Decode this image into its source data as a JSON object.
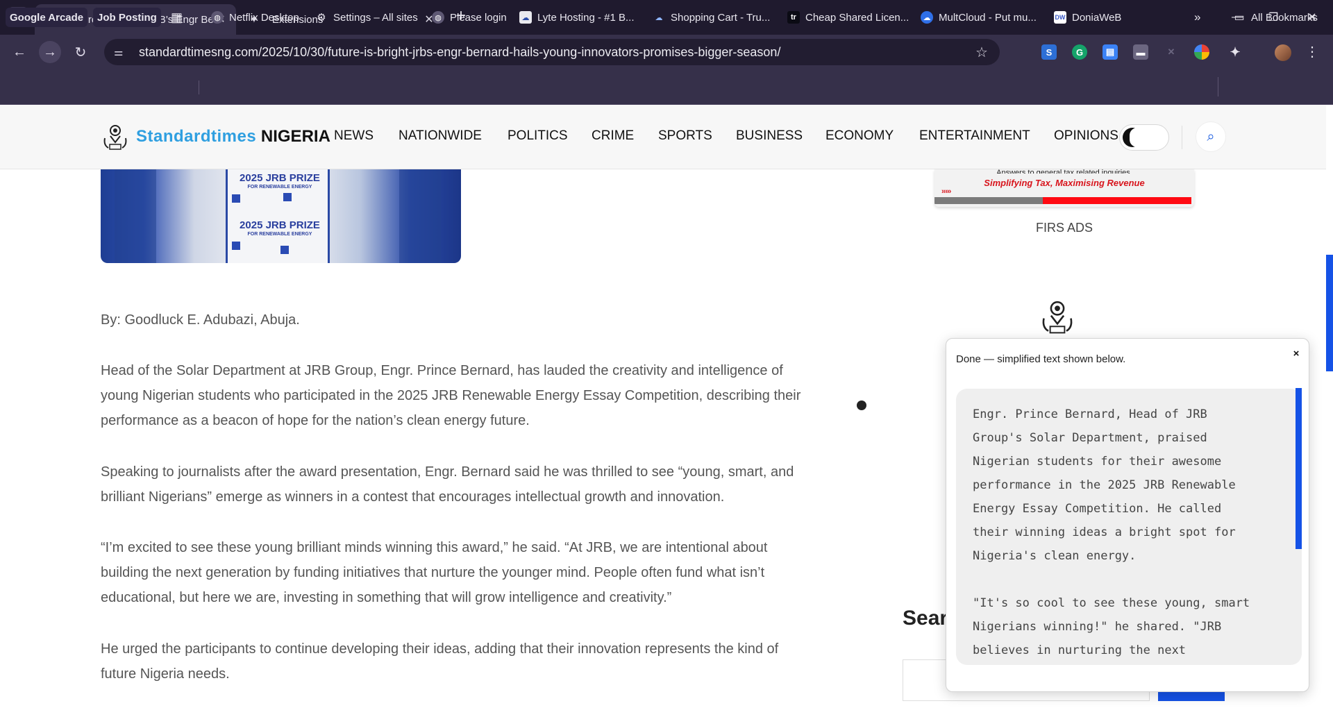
{
  "browser": {
    "tabs": [
      {
        "title": "'Future Is Bright': JRB's Engr Bernard",
        "favicon": "site-logo-icon",
        "active": true
      },
      {
        "title": "Extensions",
        "favicon": "puzzle-icon",
        "active": false
      }
    ],
    "url": "standardtimesng.com/2025/10/30/future-is-bright-jrbs-engr-bernard-hails-young-innovators-promises-bigger-season/",
    "bookmarks": [
      {
        "label": "Google Arcade",
        "icon": "none",
        "chip": true
      },
      {
        "label": "Job Posting",
        "icon": "none",
        "chip": true
      },
      {
        "label": "Netflix Desktop",
        "icon": "globe-icon"
      },
      {
        "label": "Settings – All sites",
        "icon": "gear-icon"
      },
      {
        "label": "Please login",
        "icon": "globe-icon"
      },
      {
        "label": "Lyte Hosting - #1 B...",
        "icon": "cloud-icon"
      },
      {
        "label": "Shopping Cart - Tru...",
        "icon": "cloud-icon"
      },
      {
        "label": "Cheap Shared Licen...",
        "icon": "tr-icon"
      },
      {
        "label": "MultCloud - Put mu...",
        "icon": "cloud-icon"
      },
      {
        "label": "DoniaWeB",
        "icon": "dw-icon"
      }
    ],
    "all_bookmarks": "All Bookmarks",
    "colors": {
      "frame": "#1f1a2e",
      "toolbar": "#36304a",
      "accent": "#1552e6"
    }
  },
  "site": {
    "logo_part1": "Standardtimes",
    "logo_part2": "NIGERIA",
    "nav": [
      "NEWS",
      "NATIONWIDE",
      "POLITICS",
      "CRIME",
      "SPORTS",
      "BUSINESS",
      "ECONOMY",
      "ENTERTAINMENT",
      "OPINIONS"
    ],
    "brand_color": "#2f9fe0"
  },
  "article": {
    "image_text": {
      "prize": "2025 JRB PRIZE",
      "sub": "FOR RENEWABLE ENERGY"
    },
    "byline": "By: Goodluck E. Adubazi, Abuja.",
    "paragraphs": [
      [
        "Head of the Solar Department at JRB Group, Engr. Prince Bernard, has lauded the creativity and intelligence of",
        "young Nigerian students who participated in the 2025 JRB Renewable Energy Essay Competition, describing their",
        "performance as a beacon of hope for the nation’s clean energy future."
      ],
      [
        "Speaking to journalists after the award presentation, Engr. Bernard said he was thrilled to see “young, smart, and",
        "brilliant Nigerians” emerge as winners in a contest that encourages intellectual growth and innovation."
      ],
      [
        "“I’m excited to see these young brilliant minds winning this award,” he said. “At JRB, we are intentional about",
        "building the next generation by funding initiatives that nurture the younger mind. People often fund what isn’t",
        "educational, but here we are, investing in something that will grow intelligence and creativity.”"
      ],
      [
        "He urged the participants to continue developing their ideas, adding that their innovation represents the kind of",
        "future Nigeria needs."
      ]
    ]
  },
  "sidebar": {
    "ad_top_text": "Answers to general tax related inquiries.",
    "ad_tagline": "Simplifying Tax, Maximising Revenue",
    "ad_arrows": "›››››",
    "ad_caption": "FIRS ADS",
    "search_title": "Sear"
  },
  "popup": {
    "status": "Done — simplified text shown below.",
    "close": "×",
    "lines": [
      "Engr. Prince Bernard, Head of JRB",
      "Group's Solar Department, praised",
      "Nigerian students for their awesome",
      "performance in the 2025 JRB Renewable",
      "Energy Essay Competition. He called",
      "their winning ideas a bright spot for",
      "Nigeria's clean energy.",
      "",
      "\"It's so cool to see these young, smart",
      "Nigerians winning!\" he shared. \"JRB",
      "believes in nurturing the next"
    ]
  }
}
